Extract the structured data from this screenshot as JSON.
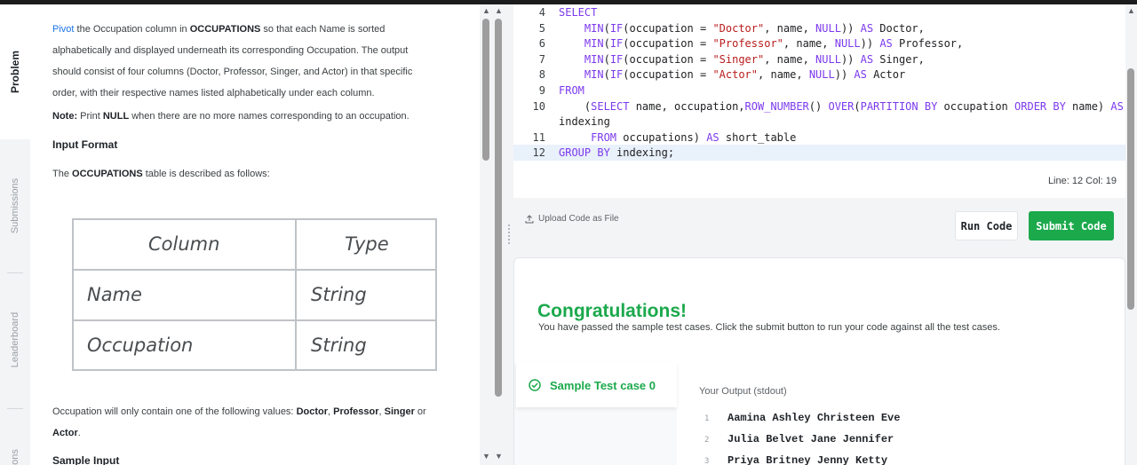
{
  "tabs": {
    "problem": "Problem",
    "submissions": "Submissions",
    "leaderboard": "Leaderboard",
    "discussions": "ons"
  },
  "problem": {
    "link_word": "Pivot",
    "p1_a": " the Occupation column in ",
    "p1_table": "OCCUPATIONS",
    "p1_b": " so that each Name is sorted",
    "p1_line2": "alphabetically and displayed underneath its corresponding Occupation. The output",
    "p1_line3": "should consist of four columns (Doctor, Professor, Singer, and Actor) in that specific",
    "p1_line4": "order, with their respective names listed alphabetically under each column.",
    "note_label": "Note:",
    "note_a": " Print ",
    "note_null": "NULL",
    "note_b": " when there are no more names corresponding to an occupation.",
    "input_format": "Input Format",
    "desc_a": "The ",
    "desc_table": "OCCUPATIONS",
    "desc_b": " table is described as follows:",
    "table": {
      "headers": [
        "Column",
        "Type"
      ],
      "rows": [
        [
          "Name",
          "String"
        ],
        [
          "Occupation",
          "String"
        ]
      ]
    },
    "values_a": "Occupation will only contain one of the following values: ",
    "v1": "Doctor",
    "v2": "Professor",
    "v3": "Singer",
    "or": " or",
    "v4": "Actor",
    "sample_input": "Sample Input"
  },
  "editor": {
    "lines": [
      {
        "n": "4",
        "parts": [
          [
            "kw",
            "SELECT"
          ]
        ]
      },
      {
        "n": "5",
        "parts": [
          [
            "",
            "    "
          ],
          [
            "kw",
            "MIN"
          ],
          [
            "",
            "("
          ],
          [
            "kw",
            "IF"
          ],
          [
            "",
            "(occupation = "
          ],
          [
            "str",
            "\"Doctor\""
          ],
          [
            "",
            ", name, "
          ],
          [
            "kw",
            "NULL"
          ],
          [
            "",
            ")) "
          ],
          [
            "kw",
            "AS"
          ],
          [
            "",
            " Doctor,"
          ]
        ]
      },
      {
        "n": "6",
        "parts": [
          [
            "",
            "    "
          ],
          [
            "kw",
            "MIN"
          ],
          [
            "",
            "("
          ],
          [
            "kw",
            "IF"
          ],
          [
            "",
            "(occupation = "
          ],
          [
            "str",
            "\"Professor\""
          ],
          [
            "",
            ", name, "
          ],
          [
            "kw",
            "NULL"
          ],
          [
            "",
            ")) "
          ],
          [
            "kw",
            "AS"
          ],
          [
            "",
            " Professor,"
          ]
        ]
      },
      {
        "n": "7",
        "parts": [
          [
            "",
            "    "
          ],
          [
            "kw",
            "MIN"
          ],
          [
            "",
            "("
          ],
          [
            "kw",
            "IF"
          ],
          [
            "",
            "(occupation = "
          ],
          [
            "str",
            "\"Singer\""
          ],
          [
            "",
            ", name, "
          ],
          [
            "kw",
            "NULL"
          ],
          [
            "",
            ")) "
          ],
          [
            "kw",
            "AS"
          ],
          [
            "",
            " Singer,"
          ]
        ]
      },
      {
        "n": "8",
        "parts": [
          [
            "",
            "    "
          ],
          [
            "kw",
            "MIN"
          ],
          [
            "",
            "("
          ],
          [
            "kw",
            "IF"
          ],
          [
            "",
            "(occupation = "
          ],
          [
            "str",
            "\"Actor\""
          ],
          [
            "",
            ", name, "
          ],
          [
            "kw",
            "NULL"
          ],
          [
            "",
            ")) "
          ],
          [
            "kw",
            "AS"
          ],
          [
            "",
            " Actor"
          ]
        ]
      },
      {
        "n": "9",
        "parts": [
          [
            "kw",
            "FROM"
          ]
        ]
      },
      {
        "n": "10",
        "parts": [
          [
            "",
            "    ("
          ],
          [
            "kw",
            "SELECT"
          ],
          [
            "",
            " name, occupation,"
          ],
          [
            "kw",
            "ROW_NUMBER"
          ],
          [
            "",
            "() "
          ],
          [
            "kw",
            "OVER"
          ],
          [
            "",
            "("
          ],
          [
            "kw",
            "PARTITION BY"
          ],
          [
            "",
            " occupation "
          ],
          [
            "kw",
            "ORDER BY"
          ],
          [
            "",
            " name) "
          ],
          [
            "kw",
            "AS"
          ]
        ]
      },
      {
        "n": "",
        "parts": [
          [
            "",
            "indexing"
          ]
        ]
      },
      {
        "n": "11",
        "parts": [
          [
            "",
            "     "
          ],
          [
            "kw",
            "FROM"
          ],
          [
            "",
            " occupations) "
          ],
          [
            "kw",
            "AS"
          ],
          [
            "",
            " short_table"
          ]
        ]
      },
      {
        "n": "12",
        "parts": [
          [
            "kw",
            "GROUP BY"
          ],
          [
            "",
            " indexing;"
          ]
        ]
      }
    ],
    "status": "Line: 12 Col: 19"
  },
  "actions": {
    "upload": "Upload Code as File",
    "run": "Run Code",
    "submit": "Submit Code"
  },
  "result": {
    "title": "Congratulations!",
    "message": "You have passed the sample test cases. Click the submit button to run your code against all the test cases.",
    "testcase": "Sample Test case 0",
    "output_label": "Your Output (stdout)",
    "output": [
      {
        "n": "1",
        "text": "Aamina Ashley Christeen Eve"
      },
      {
        "n": "2",
        "text": "Julia Belvet Jane Jennifer"
      },
      {
        "n": "3",
        "text": "Priya Britney Jenny Ketty"
      }
    ]
  },
  "colors": {
    "accent_green": "#1ba94c",
    "link_blue": "#1a73e8",
    "keyword": "#7c3aed",
    "string": "#b91c1c"
  }
}
